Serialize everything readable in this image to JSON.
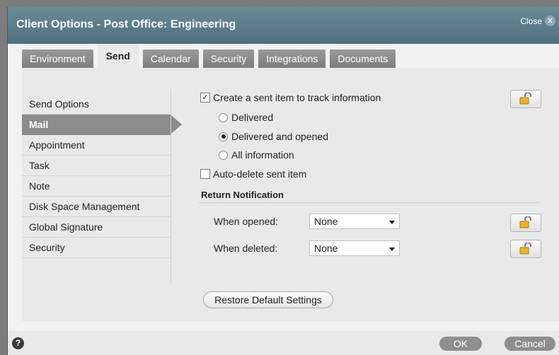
{
  "dialog": {
    "title": "Client Options - Post Office: Engineering",
    "close_label": "Close",
    "close_icon": "x"
  },
  "tabs": [
    {
      "label": "Environment",
      "active": false
    },
    {
      "label": "Send",
      "active": true
    },
    {
      "label": "Calendar",
      "active": false
    },
    {
      "label": "Security",
      "active": false
    },
    {
      "label": "Integrations",
      "active": false
    },
    {
      "label": "Documents",
      "active": false
    }
  ],
  "sidebar": {
    "items": [
      {
        "label": "Send Options"
      },
      {
        "label": "Mail",
        "selected": true
      },
      {
        "label": "Appointment"
      },
      {
        "label": "Task"
      },
      {
        "label": "Note"
      },
      {
        "label": "Disk Space Management"
      },
      {
        "label": "Global Signature"
      },
      {
        "label": "Security"
      }
    ]
  },
  "form": {
    "create_sent_item": {
      "label": "Create a sent item to track information",
      "checked": true
    },
    "tracking_options": [
      {
        "label": "Delivered",
        "selected": false
      },
      {
        "label": "Delivered and opened",
        "selected": true
      },
      {
        "label": "All information",
        "selected": false
      }
    ],
    "auto_delete": {
      "label": "Auto-delete sent item",
      "checked": false
    },
    "return_notification": {
      "heading": "Return Notification",
      "when_opened": {
        "label": "When opened:",
        "value": "None"
      },
      "when_deleted": {
        "label": "When deleted:",
        "value": "None"
      }
    },
    "restore_label": "Restore Default Settings",
    "lock_icon": "unlocked-padlock-icon"
  },
  "footer": {
    "help_icon": "?",
    "ok_label": "OK",
    "cancel_label": "Cancel"
  },
  "colors": {
    "titlebar": "#5b7b8a",
    "selected_nav": "#8c8c8c",
    "inactive_tab": "#8a8a8a"
  }
}
